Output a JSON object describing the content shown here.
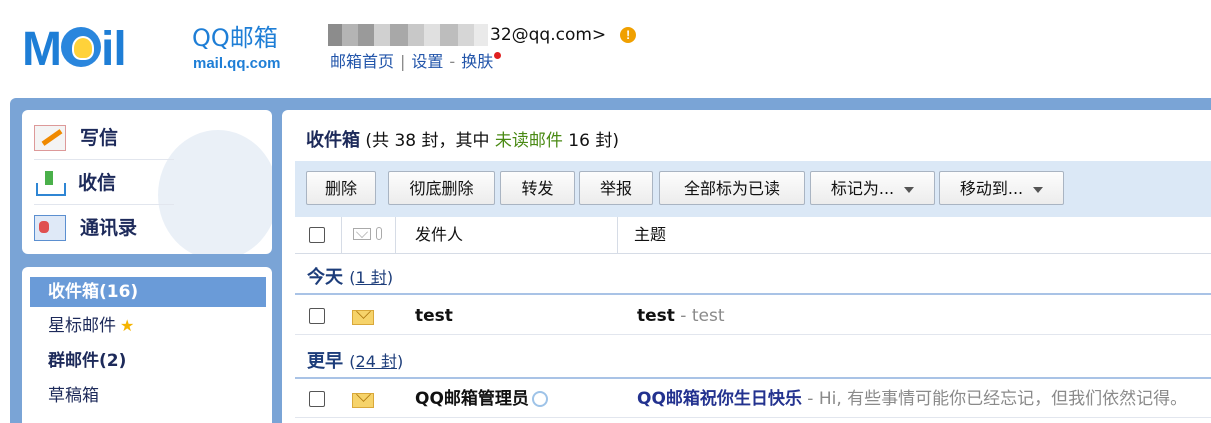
{
  "header": {
    "logo_text": "M",
    "logo_text2": "il",
    "logo_brand": "QQ邮箱",
    "logo_url": "mail.qq.com",
    "account_suffix": "32@qq.com>",
    "warn_icon": "!",
    "links": {
      "home": "邮箱首页",
      "settings": "设置",
      "skin": "换肤"
    }
  },
  "quick_actions": {
    "write": "写信",
    "receive": "收信",
    "contacts": "通讯录"
  },
  "folders": [
    {
      "label": "收件箱(16)"
    },
    {
      "label": "星标邮件"
    },
    {
      "label": "群邮件(2)"
    },
    {
      "label": "草稿箱"
    }
  ],
  "inbox": {
    "title": "收件箱",
    "summary_pre": "(共 38 封，其中 ",
    "unread_label": "未读邮件",
    "summary_post": " 16 封)"
  },
  "toolbar": {
    "delete": "删除",
    "delete_forever": "彻底删除",
    "forward": "转发",
    "report": "举报",
    "mark_all_read": "全部标为已读",
    "mark_as": "标记为...",
    "move_to": "移动到..."
  },
  "table": {
    "col_sender": "发件人",
    "col_subject": "主题"
  },
  "groups": [
    {
      "name": "今天",
      "count_pre": "(",
      "count": "1 封",
      "count_post": ")",
      "emails": [
        {
          "sender": "test",
          "subject": "test",
          "preview": " - test"
        }
      ]
    },
    {
      "name": "更早",
      "count_pre": "(",
      "count": "24 封",
      "count_post": ")",
      "emails": [
        {
          "sender": "QQ邮箱管理员",
          "subject": "QQ邮箱祝你生日快乐",
          "preview": " - Hi, 有些事情可能你已经忘记，但我们依然记得。"
        }
      ]
    }
  ]
}
